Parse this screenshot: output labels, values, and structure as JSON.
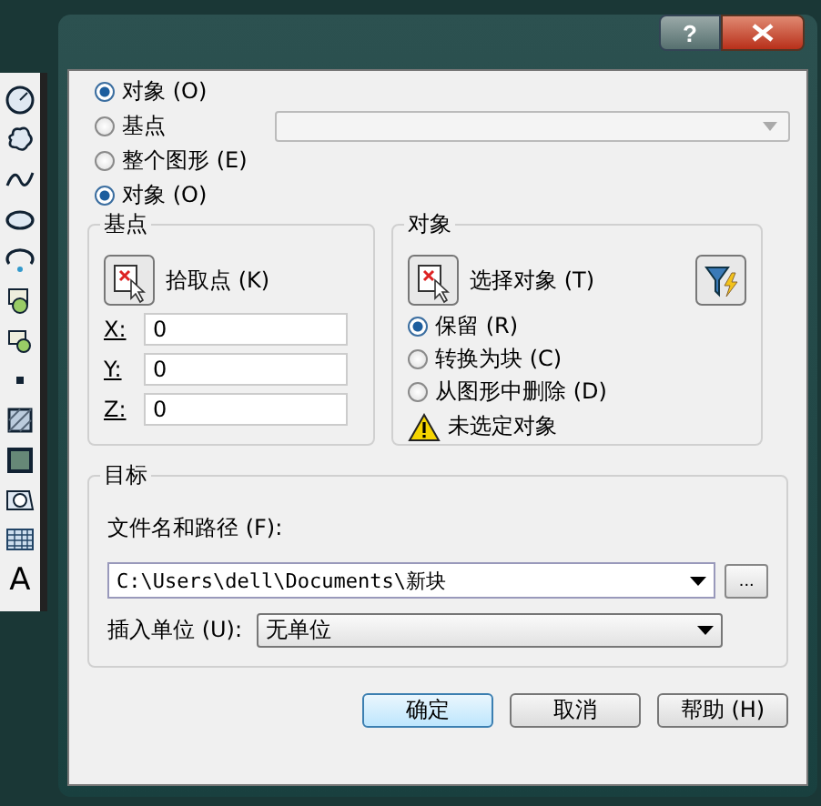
{
  "window": {
    "help_button": "?"
  },
  "source": [
    {
      "label": "对象 (O)",
      "selected": true
    },
    {
      "label": "基点",
      "selected": false,
      "dropdown": {
        "disabled": true
      }
    },
    {
      "label": "整个图形 (E)",
      "selected": false
    },
    {
      "label": "对象 (O)",
      "selected": true
    }
  ],
  "base_point": {
    "title": "基点",
    "pick_button": "拾取点 (K)",
    "coords": [
      {
        "axis": "X:",
        "value": "0"
      },
      {
        "axis": "Y:",
        "value": "0"
      },
      {
        "axis": "Z:",
        "value": "0"
      }
    ]
  },
  "objects": {
    "title": "对象",
    "select_button": "选择对象 (T)",
    "options": [
      {
        "label": "保留 (R)",
        "selected": true
      },
      {
        "label": "转换为块 (C)",
        "selected": false
      },
      {
        "label": "从图形中删除 (D)",
        "selected": false
      }
    ],
    "warning": "未选定对象"
  },
  "destination": {
    "title": "目标",
    "file_label": "文件名和路径 (F):",
    "file_path": "C:\\Users\\dell\\Documents\\新块",
    "browse": "...",
    "unit_label": "插入单位 (U):",
    "unit": "无单位"
  },
  "buttons": [
    {
      "label": "确定",
      "default": true
    },
    {
      "label": "取消",
      "default": false
    },
    {
      "label": "帮助 (H)",
      "default": false
    }
  ],
  "toolbar": {
    "text_tool": "A"
  }
}
